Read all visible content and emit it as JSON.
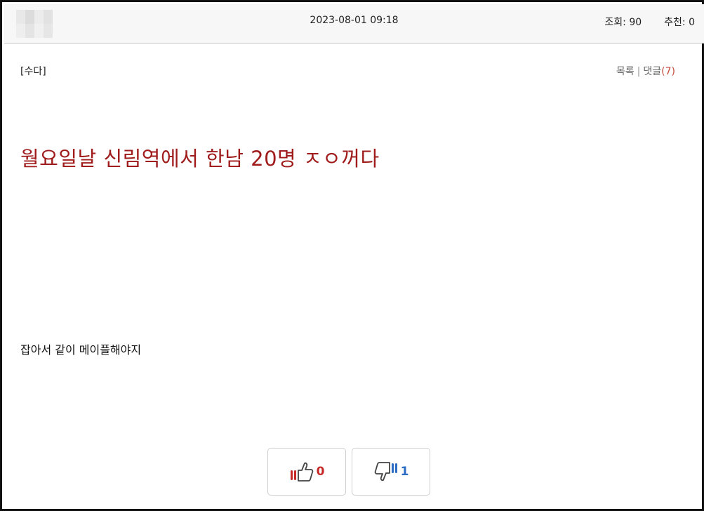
{
  "header": {
    "datetime": "2023-08-01 09:18",
    "views_label": "조회:",
    "views_value": "90",
    "recommend_label": "추천:",
    "recommend_value": "0"
  },
  "post": {
    "category": "[수다]",
    "list_link": "목록",
    "separator": "|",
    "comments_label": "댓글",
    "comments_count": "(7)",
    "title": "월요일날 신림역에서 한남 20명 ㅈㅇ꺼다",
    "body": "잡아서 같이 메이플해야지"
  },
  "votes": {
    "up_icon": "thumbs-up-icon",
    "up_count": "0",
    "down_icon": "thumbs-down-icon",
    "down_count": "1"
  },
  "colors": {
    "title": "#a01c1c",
    "comments_count": "#c44a3a",
    "upvote": "#c62828",
    "downvote": "#2a6cc4"
  }
}
